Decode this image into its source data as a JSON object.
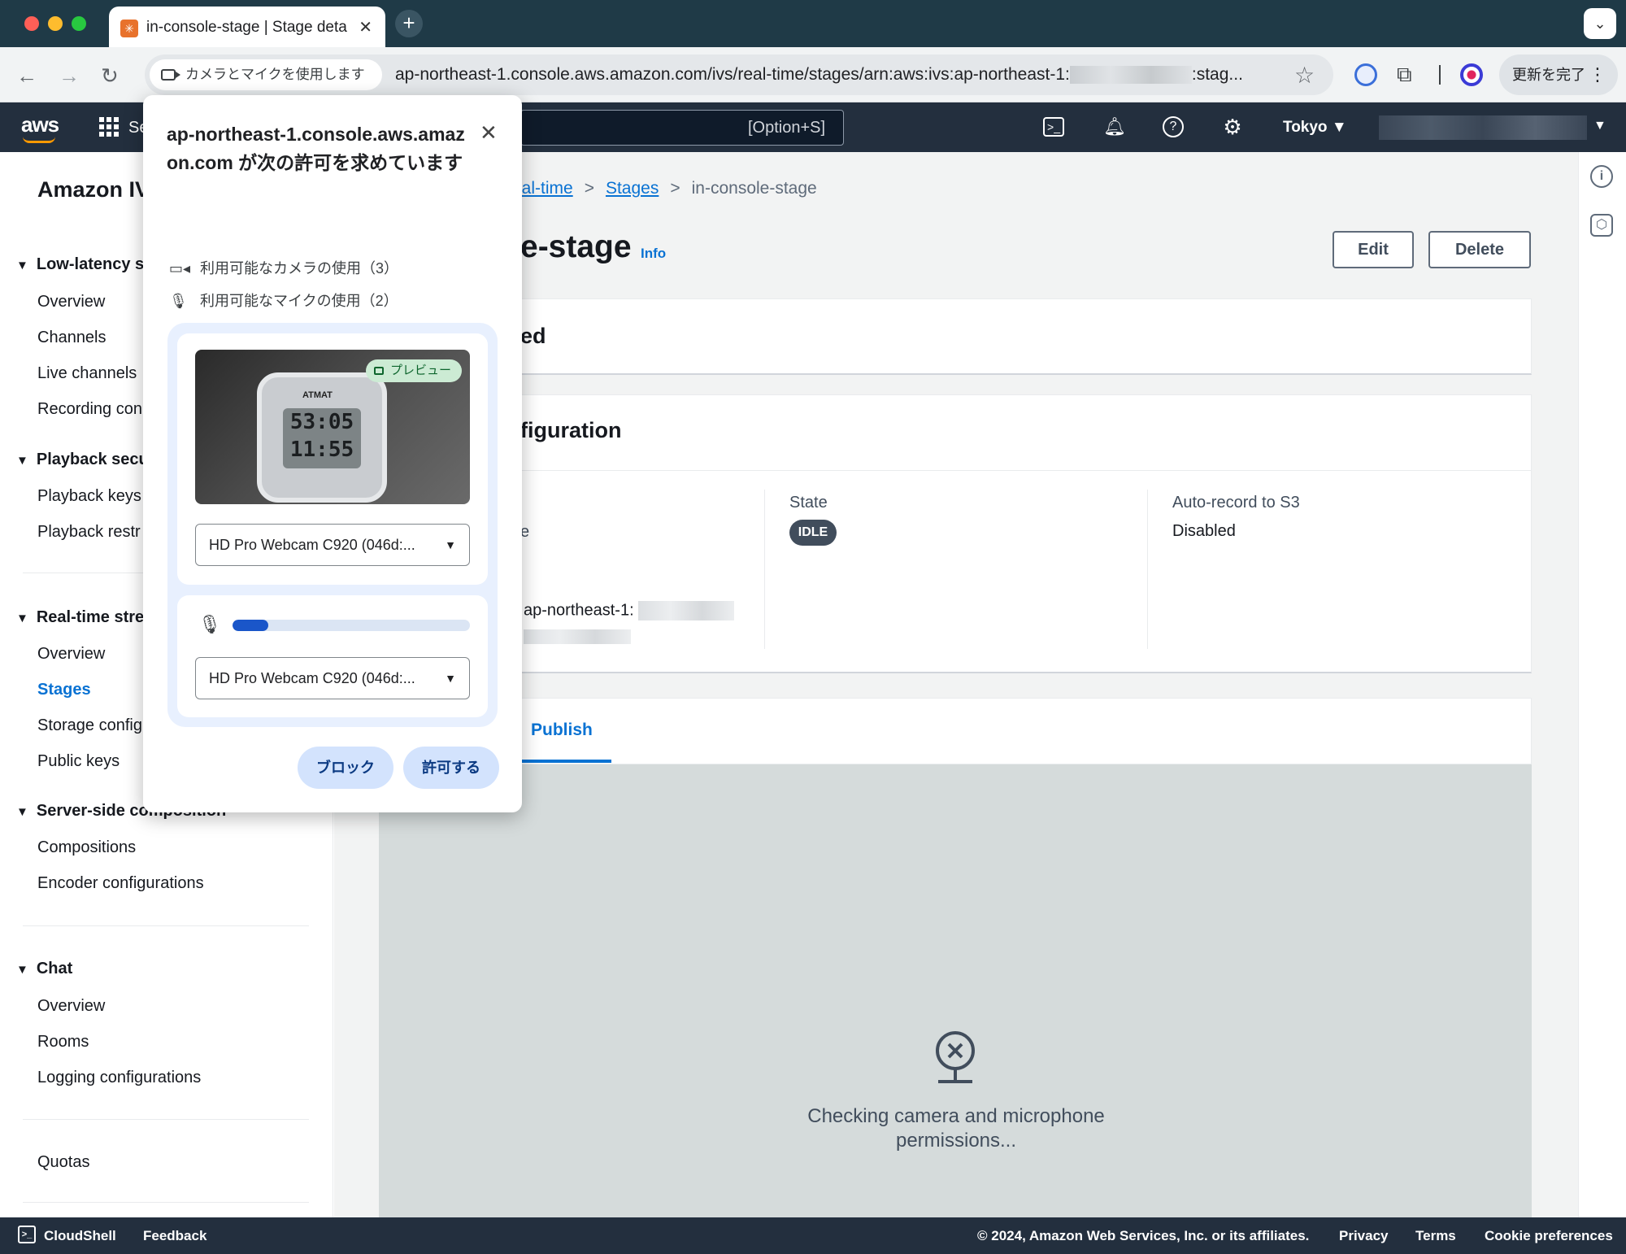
{
  "browser": {
    "tab_title": "in-console-stage | Stage deta",
    "tab_close": "✕",
    "new_tab": "+",
    "permission_chip": "カメラとマイクを使用しますか？",
    "url_prefix": "ap-northeast-1.console.aws.amazon.com/ivs/real-time/stages/arn:aws:ivs:ap-northeast-1:",
    "url_suffix": ":stag...",
    "update_button": "更新を完了"
  },
  "aws_nav": {
    "logo": "aws",
    "services_label": "Se",
    "search_hint": "[Option+S]",
    "region": "Tokyo ▼"
  },
  "sidebar": {
    "title": "Amazon IV",
    "sections": [
      {
        "label": "Low-latency s",
        "items": [
          "Overview",
          "Channels",
          "Live channels",
          "Recording con"
        ]
      },
      {
        "label": "Playback secu",
        "items": [
          "Playback keys",
          "Playback restr"
        ]
      },
      {
        "label": "Real-time stre",
        "items": [
          "Overview",
          "Stages",
          "Storage config",
          "Public keys"
        ]
      },
      {
        "label": "Server-side composition",
        "items": [
          "Compositions",
          "Encoder configurations"
        ]
      },
      {
        "label": "Chat",
        "items": [
          "Overview",
          "Rooms",
          "Logging configurations"
        ]
      }
    ],
    "quotas": "Quotas",
    "active_item": "Stages"
  },
  "main": {
    "breadcrumb": {
      "crumb1": "eal-time",
      "crumb2": "Stages",
      "current": "in-console-stage"
    },
    "title": "e-stage",
    "info": "Info",
    "edit_button": "Edit",
    "delete_button": "Delete",
    "panel1_title": "ed",
    "panel2_title": "figuration",
    "col1_label_fragment": "e",
    "arn_fragment": "ap-northeast-1:",
    "state_label": "State",
    "state_value": "IDLE",
    "autorecord_label": "Auto-record to S3",
    "autorecord_value": "Disabled",
    "publish_tab": "Publish",
    "checking_message": "Checking camera and microphone permissions..."
  },
  "popup": {
    "heading": "ap-northeast-1.console.aws.amazon.com が次の許可を求めています",
    "camera_permission": "利用可能なカメラの使用（3）",
    "mic_permission": "利用可能なマイクの使用（2）",
    "preview_badge": "プレビュー",
    "camera_device": "HD Pro Webcam C920 (046d:...",
    "mic_device": "HD Pro Webcam C920 (046d:...",
    "mic_level": 0.15,
    "block_button": "ブロック",
    "allow_button": "許可する",
    "clock_brand": "ATMAT",
    "clock_line1": "53:05",
    "clock_line2": "11:55"
  },
  "footer": {
    "cloudshell": "CloudShell",
    "feedback": "Feedback",
    "copyright": "© 2024, Amazon Web Services, Inc. or its affiliates.",
    "privacy": "Privacy",
    "terms": "Terms",
    "cookie": "Cookie preferences"
  },
  "colors": {
    "aws_nav": "#232f3e",
    "link_blue": "#0972d3",
    "aws_orange": "#ff9900",
    "chip_green": "#ccebd4",
    "permission_blue": "#d3e3fd"
  }
}
